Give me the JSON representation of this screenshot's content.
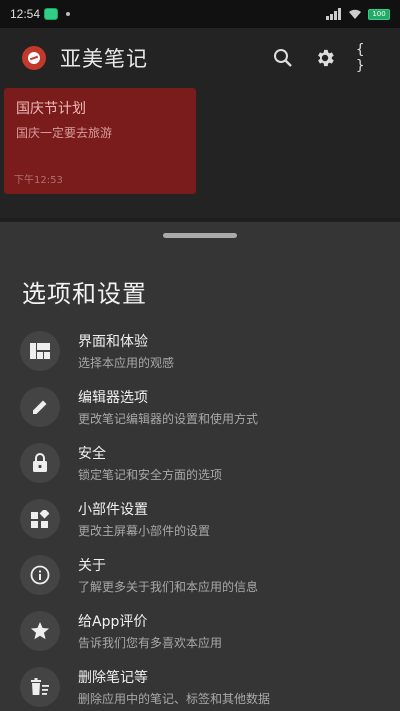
{
  "status_bar": {
    "time": "12:54",
    "battery": "100"
  },
  "app_bar": {
    "title": "亚美笔记",
    "actions": [
      {
        "icon": "search-icon"
      },
      {
        "icon": "gear-icon"
      },
      {
        "icon": "braces-icon",
        "glyph": "{ }"
      }
    ]
  },
  "note": {
    "title": "国庆节计划",
    "body": "国庆一定要去旅游",
    "time": "下午12:53",
    "color": "#7a1c1c"
  },
  "sheet": {
    "title": "选项和设置",
    "items": [
      {
        "icon": "layout-icon",
        "label": "界面和体验",
        "sub": "选择本应用的观感"
      },
      {
        "icon": "pencil-icon",
        "label": "编辑器选项",
        "sub": "更改笔记编辑器的设置和使用方式"
      },
      {
        "icon": "lock-icon",
        "label": "安全",
        "sub": "锁定笔记和安全方面的选项"
      },
      {
        "icon": "widgets-icon",
        "label": "小部件设置",
        "sub": "更改主屏幕小部件的设置"
      },
      {
        "icon": "info-icon",
        "label": "关于",
        "sub": "了解更多关于我们和本应用的信息"
      },
      {
        "icon": "star-icon",
        "label": "给App评价",
        "sub": "告诉我们您有多喜欢本应用"
      },
      {
        "icon": "trash-icon",
        "label": "删除笔记等",
        "sub": "删除应用中的笔记、标签和其他数据"
      }
    ]
  }
}
